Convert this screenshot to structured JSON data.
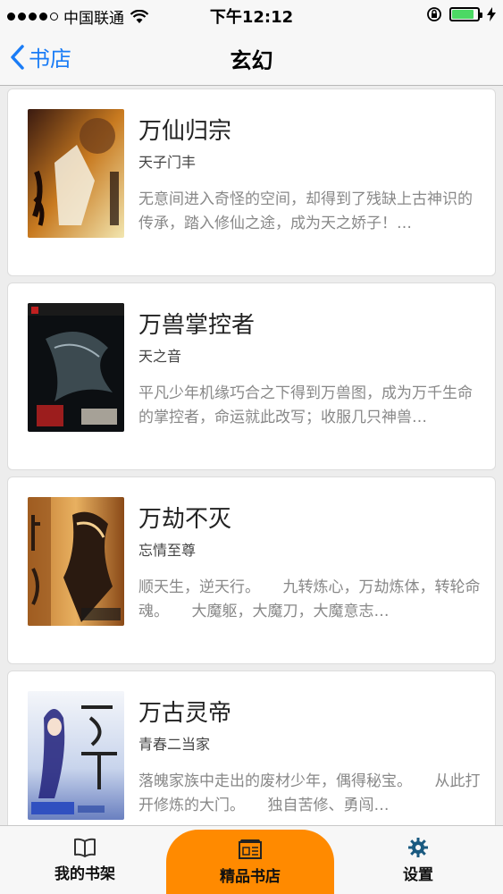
{
  "status_bar": {
    "carrier": "中国联通",
    "time": "下午12:12",
    "battery_percent": 0.85
  },
  "nav": {
    "back_label": "书店",
    "title": "玄幻"
  },
  "books": [
    {
      "title": "万仙归宗",
      "author": "天子门丰",
      "description": "无意间进入奇怪的空间，却得到了残缺上古神识的传承，踏入修仙之途，成为天之娇子！…",
      "cover_colors": [
        "#3a1a10",
        "#c87a20",
        "#f2e6b0"
      ]
    },
    {
      "title": "万兽掌控者",
      "author": "天之音",
      "description": "平凡少年机缘巧合之下得到万兽图，成为万千生命的掌控者，命运就此改写；收服几只神兽…",
      "cover_colors": [
        "#0c0f12",
        "#3c4a50",
        "#c02020"
      ]
    },
    {
      "title": "万劫不灭",
      "author": "忘情至尊",
      "description": "顺天生，逆天行。　　九转炼心，万劫炼体，转轮命魂。　　大魔躯，大魔刀，大魔意志…",
      "cover_colors": [
        "#e8b060",
        "#8a4a18",
        "#2a1a10"
      ]
    },
    {
      "title": "万古灵帝",
      "author": "青春二当家",
      "description": "落魄家族中走出的废材少年，偶得秘宝。　　从此打开修炼的大门。　　独自苦修、勇闯…",
      "cover_colors": [
        "#e8ecf4",
        "#6a80c0",
        "#20207a"
      ]
    }
  ],
  "tabs": {
    "shelf_label": "我的书架",
    "store_label": "精品书店",
    "settings_label": "设置",
    "active": "精品书店"
  },
  "colors": {
    "accent": "#1a7cf6",
    "tab_active": "#ff8a00"
  }
}
